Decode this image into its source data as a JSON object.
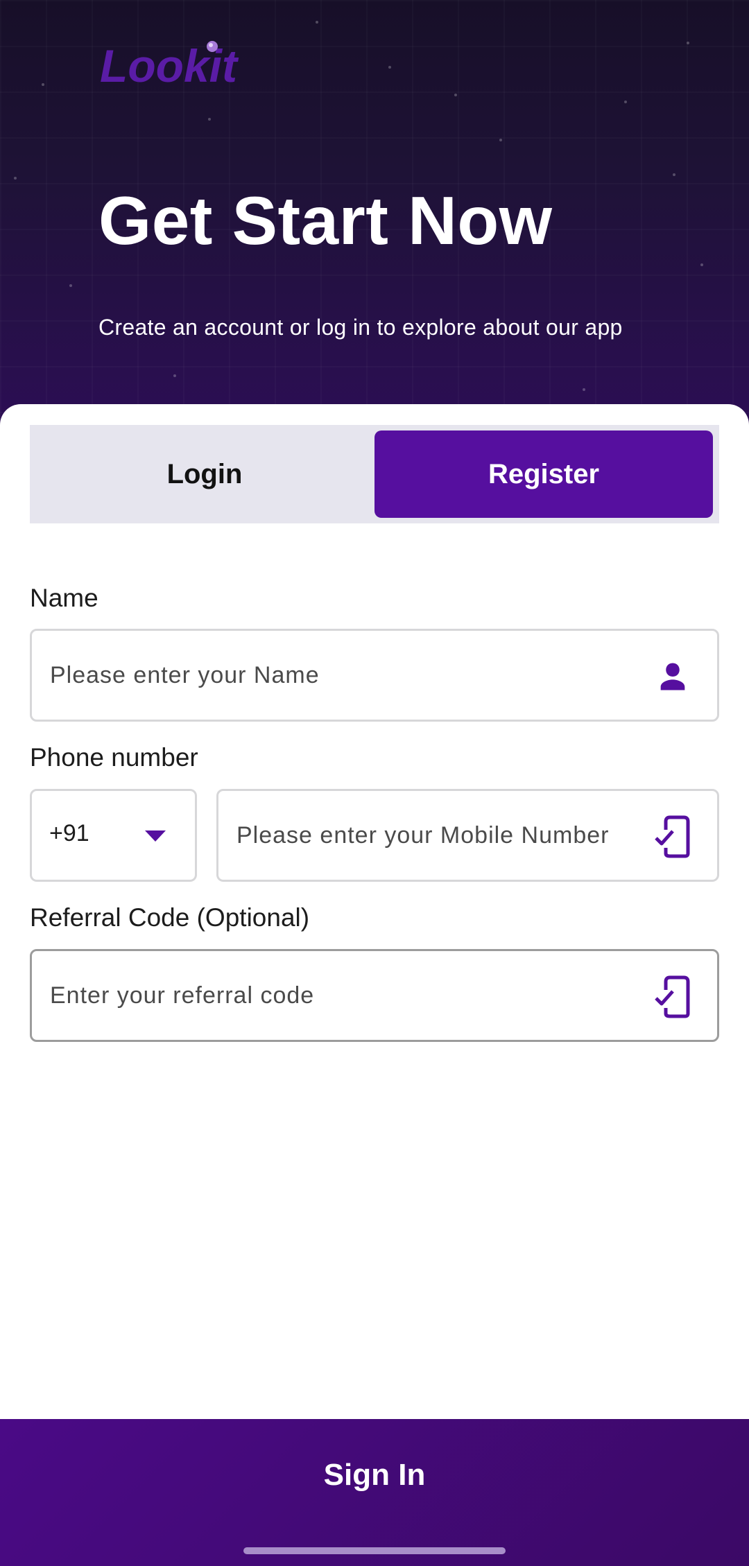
{
  "header": {
    "logo_text": "Lookit",
    "title": "Get Start Now",
    "subtitle": "Create an account or log in to explore about our app"
  },
  "tabs": [
    {
      "label": "Login",
      "selected": false
    },
    {
      "label": "Register",
      "selected": true
    }
  ],
  "form": {
    "name": {
      "label": "Name",
      "placeholder": "Please enter your Name",
      "icon": "person-icon"
    },
    "phone": {
      "label": "Phone number",
      "country_code": "+91",
      "placeholder": "Please enter your Mobile Number",
      "icon": "phone-check-icon"
    },
    "referral": {
      "label": "Referral Code (Optional)",
      "placeholder": "Enter your referral code",
      "icon": "phone-check-icon"
    }
  },
  "footer": {
    "signin_label": "Sign In"
  },
  "colors": {
    "accent": "#560f9f",
    "tab_bg": "#e6e5ee",
    "header_bg": "#1e1236"
  }
}
